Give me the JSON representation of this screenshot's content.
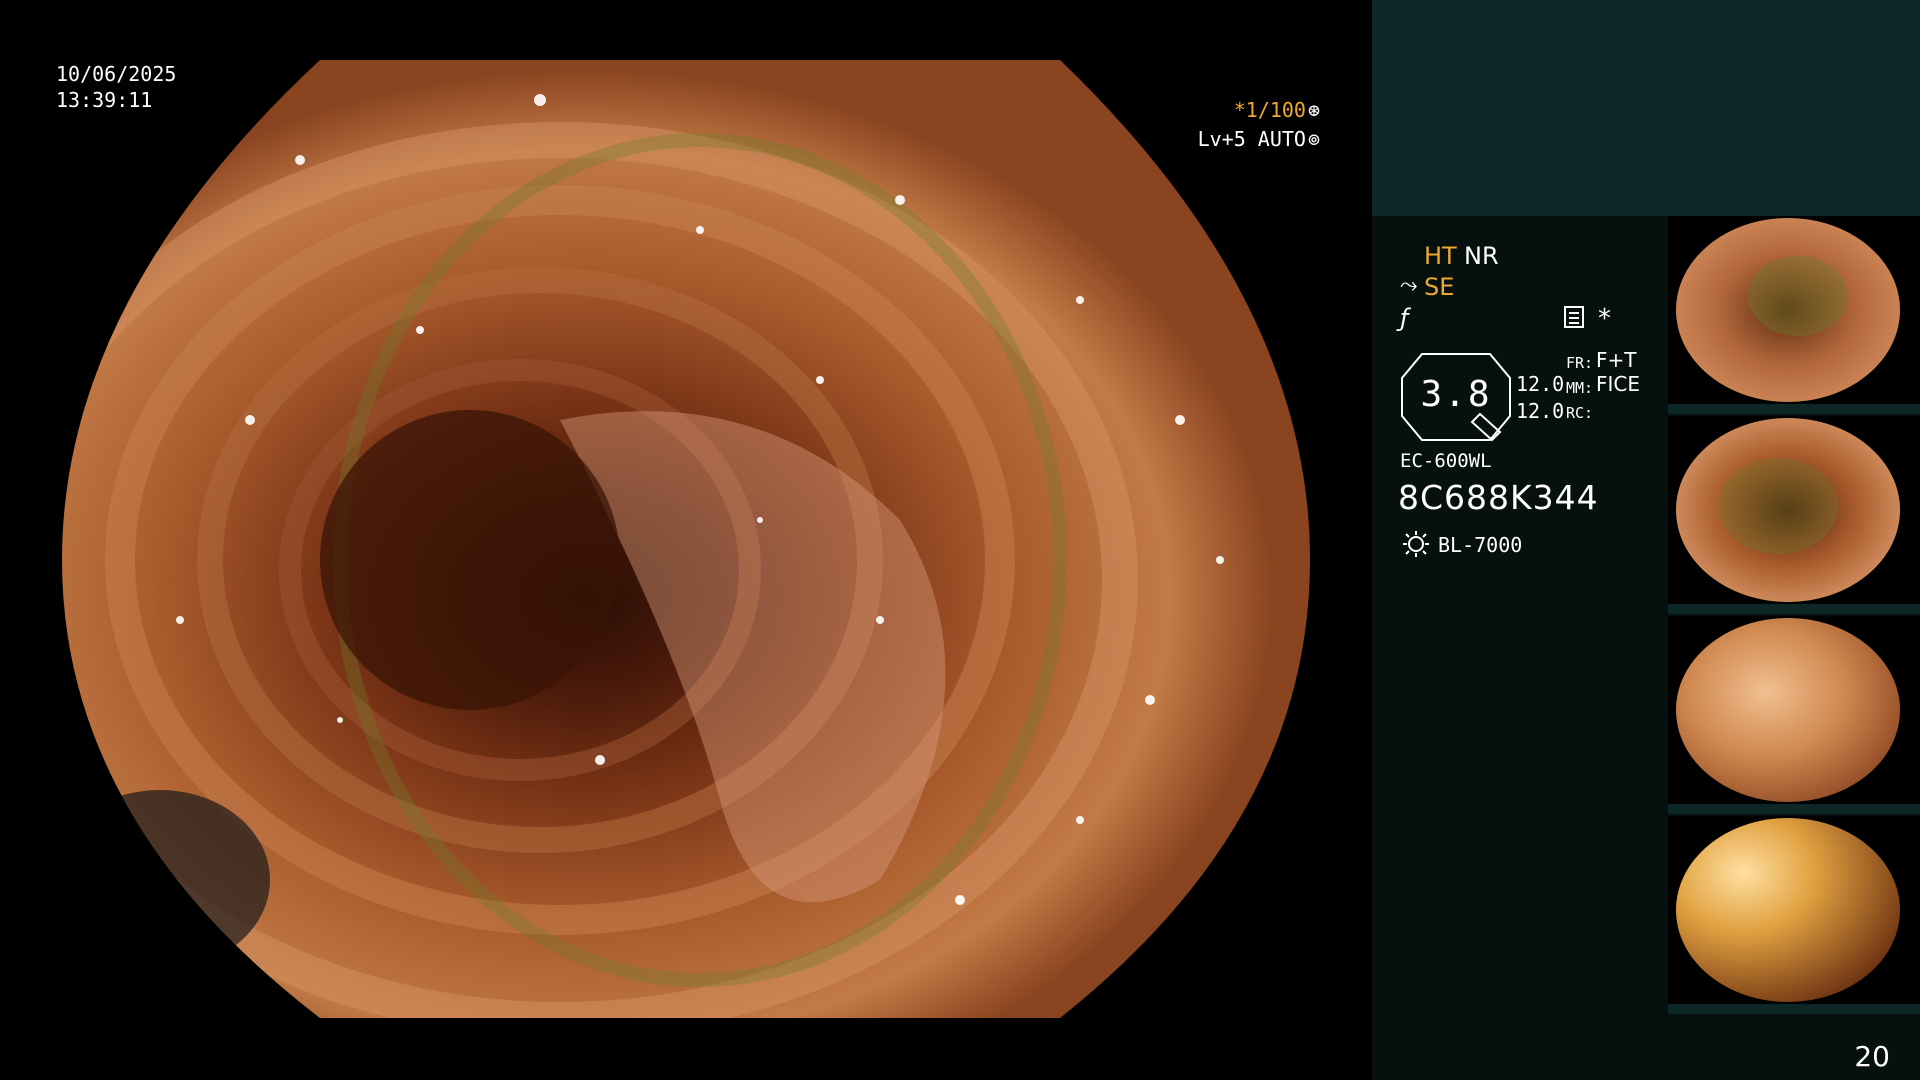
{
  "overlay": {
    "date": "10/06/2025",
    "time": "13:39:11",
    "shutter": "*1/100",
    "level": "Lv+5 AUTO"
  },
  "panel": {
    "ht": "HT",
    "nr": "NR",
    "se": "SE",
    "gauge_value": "3.8",
    "value_top": "12.0",
    "value_bottom": "12.0",
    "fr_key": "FR:",
    "fr_value": "F+T",
    "mm_key": "MM:",
    "mm_value": "FICE",
    "rc_key": "RC:",
    "rc_value": "",
    "scope_model": "EC-600WL",
    "serial": "8C688K344",
    "light_source": "BL-7000",
    "page_number": "20"
  },
  "colors": {
    "accent": "#f0a830",
    "panel_bg": "#06100f",
    "panel_teal": "#0d2626"
  },
  "icons": [
    "se-icon",
    "f-icon",
    "list-icon",
    "star-icon",
    "light-bulb-icon",
    "shutter-icon",
    "level-icon"
  ]
}
